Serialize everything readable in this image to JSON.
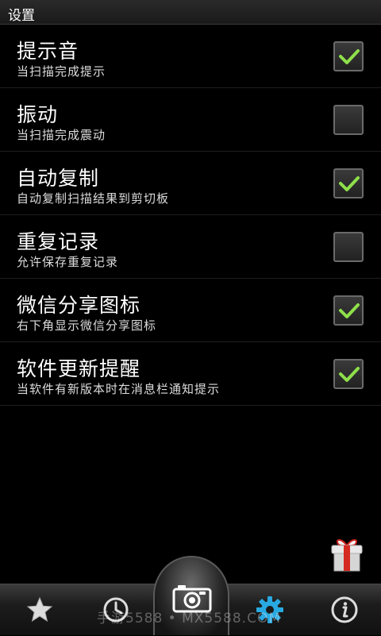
{
  "header": {
    "title": "设置"
  },
  "settings": [
    {
      "title": "提示音",
      "subtitle": "当扫描完成提示",
      "checked": true
    },
    {
      "title": "振动",
      "subtitle": "当扫描完成震动",
      "checked": false
    },
    {
      "title": "自动复制",
      "subtitle": "自动复制扫描结果到剪切板",
      "checked": true
    },
    {
      "title": "重复记录",
      "subtitle": "允许保存重复记录",
      "checked": false
    },
    {
      "title": "微信分享图标",
      "subtitle": "右下角显示微信分享图标",
      "checked": true
    },
    {
      "title": "软件更新提醒",
      "subtitle": "当软件有新版本时在消息栏通知提示",
      "checked": true
    }
  ],
  "bottom_nav": {
    "items": [
      {
        "icon": "star-icon"
      },
      {
        "icon": "history-clock-icon"
      },
      {
        "icon": "camera-icon"
      },
      {
        "icon": "gear-icon",
        "active": true
      },
      {
        "icon": "info-icon"
      }
    ]
  },
  "watermark": "手游5588 • MX5588.COM",
  "colors": {
    "accent": "#29a9e1",
    "check": "#8ee04a",
    "background": "#000000"
  }
}
